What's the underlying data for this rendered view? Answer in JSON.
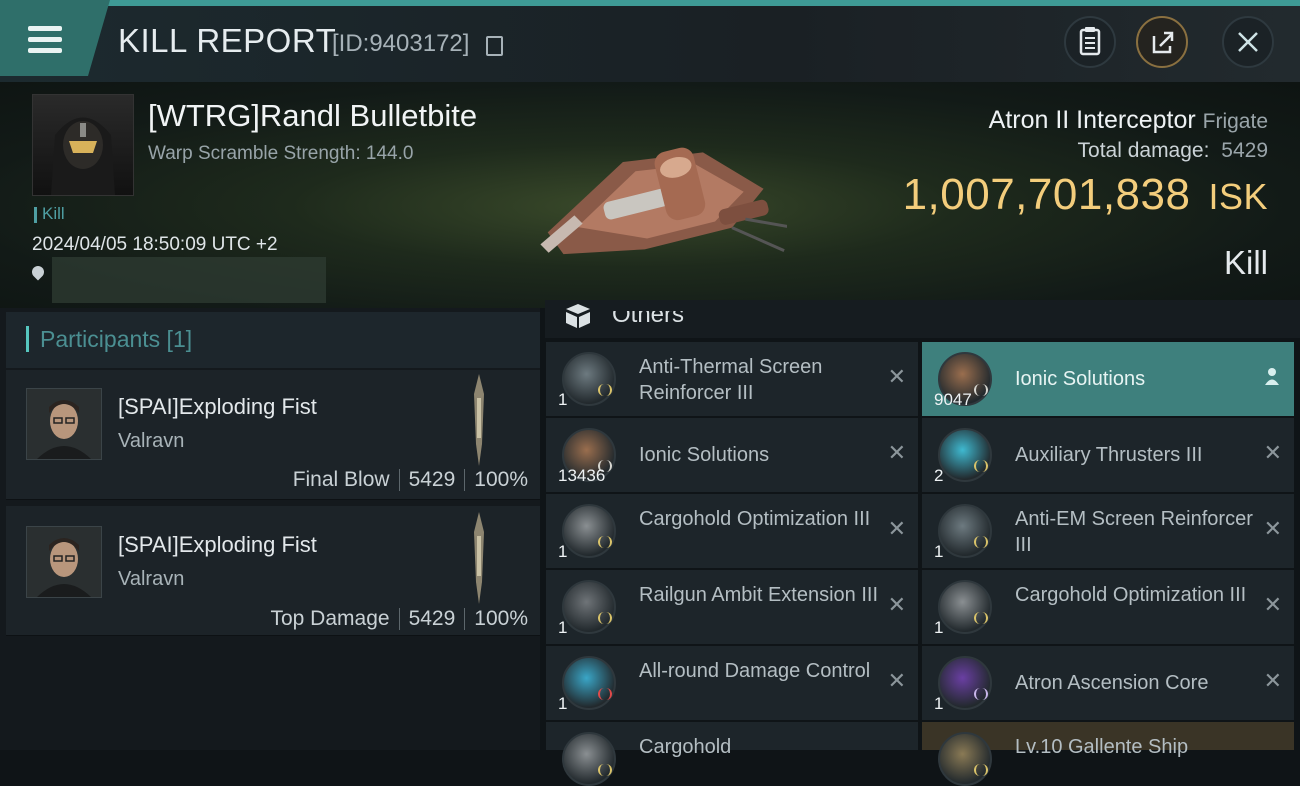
{
  "header": {
    "title": "KILL REPORT",
    "kill_id": "[ID:9403172]"
  },
  "victim": {
    "name": "[WTRG]Randl Bulletbite",
    "scram_text": "Warp Scramble Strength: 144.0",
    "tag": "Kill",
    "timestamp": "2024/04/05 18:50:09 UTC +2"
  },
  "ship": {
    "name": "Atron II Interceptor",
    "class": "Frigate",
    "total_damage_label": "Total damage:",
    "total_damage": "5429",
    "value": "1,007,701,838",
    "unit": "ISK",
    "result": "Kill"
  },
  "participants": {
    "title": "Participants [1]",
    "items": [
      {
        "name": "[SPAI]Exploding Fist",
        "corp": "Valravn",
        "role": "Final Blow",
        "damage": "5429",
        "percent": "100%"
      },
      {
        "name": "[SPAI]Exploding Fist",
        "corp": "Valravn",
        "role": "Top Damage",
        "damage": "5429",
        "percent": "100%"
      }
    ]
  },
  "others": {
    "title": "Others",
    "items": [
      {
        "name": "Anti-Thermal Screen Reinforcer III",
        "qty": "1",
        "highlighted": false,
        "icon": "shield-module-icon"
      },
      {
        "name": "Ionic Solutions",
        "qty": "9047",
        "highlighted": true,
        "icon": "canister-icon"
      },
      {
        "name": "Ionic Solutions",
        "qty": "13436",
        "highlighted": false,
        "icon": "canister-icon"
      },
      {
        "name": "Auxiliary Thrusters III",
        "qty": "2",
        "highlighted": false,
        "icon": "thruster-icon"
      },
      {
        "name": "Cargohold Optimization III",
        "qty": "1",
        "highlighted": false,
        "icon": "cargo-module-icon"
      },
      {
        "name": "Anti-EM Screen Reinforcer III",
        "qty": "1",
        "highlighted": false,
        "icon": "shield-module-icon"
      },
      {
        "name": "Railgun Ambit Extension III",
        "qty": "1",
        "highlighted": false,
        "icon": "railgun-module-icon"
      },
      {
        "name": "Cargohold Optimization III",
        "qty": "1",
        "highlighted": false,
        "icon": "cargo-module-icon"
      },
      {
        "name": "All-round Damage Control",
        "qty": "1",
        "highlighted": false,
        "icon": "damage-control-icon"
      },
      {
        "name": "Atron Ascension Core",
        "qty": "1",
        "highlighted": false,
        "icon": "core-icon"
      },
      {
        "name": "Cargohold",
        "qty": "",
        "highlighted": false,
        "icon": "cargo-module-icon"
      },
      {
        "name": "Lv.10 Gallente Ship",
        "qty": "",
        "highlighted": false,
        "icon": "blueprint-icon"
      }
    ]
  },
  "colors": {
    "accent": "#3e807d",
    "isk_gold": "#f3cd7c",
    "teal_text": "#4b8f92"
  }
}
